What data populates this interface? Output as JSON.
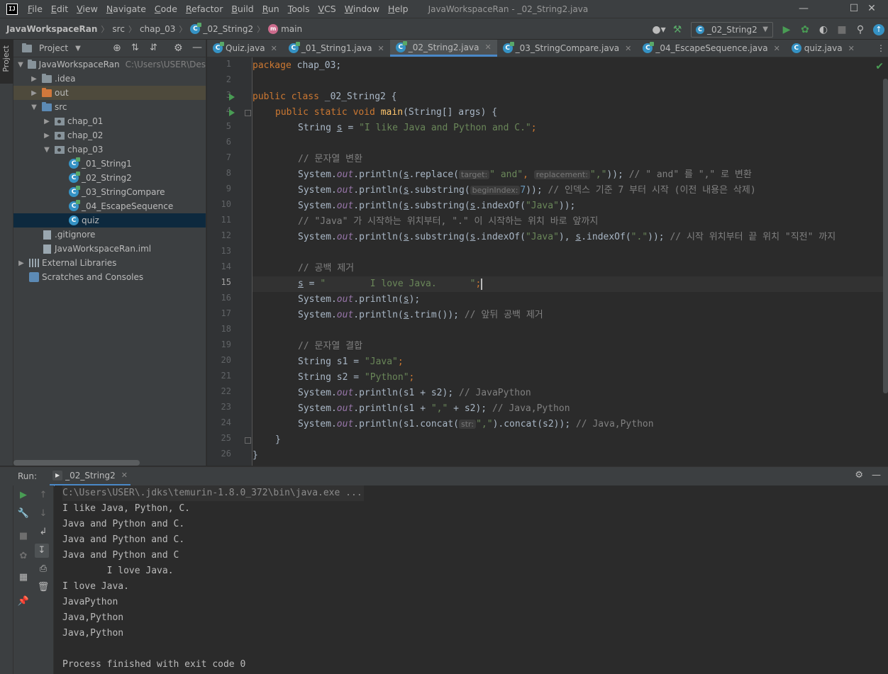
{
  "menu": {
    "items": [
      "File",
      "Edit",
      "View",
      "Navigate",
      "Code",
      "Refactor",
      "Build",
      "Run",
      "Tools",
      "VCS",
      "Window",
      "Help"
    ],
    "window_title": "JavaWorkspaceRan - _02_String2.java",
    "logo_text": "IJ"
  },
  "navbar": {
    "project": "JavaWorkspaceRan",
    "src": "src",
    "package": "chap_03",
    "class": "_02_String2",
    "method": "main",
    "run_config": "_02_String2"
  },
  "project_panel": {
    "title": "Project",
    "tree": {
      "root": "JavaWorkspaceRan",
      "root_path": "C:\\Users\\USER\\Des",
      "idea": ".idea",
      "out": "out",
      "src": "src",
      "chap01": "chap_01",
      "chap02": "chap_02",
      "chap03": "chap_03",
      "f1": "_01_String1",
      "f2": "_02_String2",
      "f3": "_03_StringCompare",
      "f4": "_04_EscapeSequence",
      "f5": "quiz",
      "gitignore": ".gitignore",
      "iml": "JavaWorkspaceRan.iml",
      "libs": "External Libraries",
      "scratches": "Scratches and Consoles"
    }
  },
  "editor_tabs": [
    "Quiz.java",
    "_01_String1.java",
    "_02_String2.java",
    "_03_StringCompare.java",
    "_04_EscapeSequence.java",
    "quiz.java"
  ],
  "editor": {
    "line_numbers": [
      "1",
      "2",
      "3",
      "4",
      "5",
      "6",
      "7",
      "8",
      "9",
      "10",
      "11",
      "12",
      "13",
      "14",
      "15",
      "16",
      "17",
      "18",
      "19",
      "20",
      "21",
      "22",
      "23",
      "24",
      "25",
      "26"
    ],
    "l1": {
      "kw": "package",
      "rest": " chap_03;"
    },
    "l3": {
      "kw": "public class",
      "rest": " _02_String2 {"
    },
    "l4": {
      "kw": "public static void",
      "fn": "main",
      "rest": "(String[] args) {"
    },
    "l5": {
      "a": "String ",
      "v": "s",
      "b": " = ",
      "str": "\"I like Java and Python and C.\"",
      "c": ";"
    },
    "l7": "// 문자열 변환",
    "l8": {
      "a": "System.",
      "out": "out",
      "b": ".println(",
      "v": "s",
      "c": ".replace(",
      "h1": "target:",
      "s1": "\" and\"",
      "d": ", ",
      "h2": "replacement:",
      "s2": "\",\"",
      "e": ")); ",
      "cm": "// \" and\" 를 \",\" 로 변환"
    },
    "l9": {
      "a": "System.",
      "out": "out",
      "b": ".println(",
      "v": "s",
      "c": ".substring(",
      "h1": "beginIndex:",
      "n": "7",
      "e": ")); ",
      "cm": "// 인덱스 기준 7 부터 시작 (이전 내용은 삭제)"
    },
    "l10": {
      "a": "System.",
      "out": "out",
      "b": ".println(",
      "v": "s",
      "c": ".substring(",
      "v2": "s",
      "d": ".indexOf(",
      "s1": "\"Java\"",
      "e": "));"
    },
    "l11": "// \"Java\" 가 시작하는 위치부터, \".\" 이 시작하는 위치 바로 앞까지",
    "l12": {
      "a": "System.",
      "out": "out",
      "b": ".println(",
      "v": "s",
      "c": ".substring(",
      "v2": "s",
      "d": ".indexOf(",
      "s1": "\"Java\"",
      "e": "), ",
      "v3": "s",
      "f": ".indexOf(",
      "s2": "\".\"",
      "g": ")); ",
      "cm": "// 시작 위치부터 끝 위치 \"직전\" 까지"
    },
    "l14": "// 공백 제거",
    "l15": {
      "v": "s",
      "b": " = ",
      "str": "\"        I love Java.      \"",
      "c": ";"
    },
    "l16": {
      "a": "System.",
      "out": "out",
      "b": ".println(",
      "v": "s",
      "e": ");"
    },
    "l17": {
      "a": "System.",
      "out": "out",
      "b": ".println(",
      "v": "s",
      "c": ".trim()); ",
      "cm": "// 앞뒤 공백 제거"
    },
    "l19": "// 문자열 결합",
    "l20": {
      "a": "String s1 = ",
      "str": "\"Java\"",
      "c": ";"
    },
    "l21": {
      "a": "String s2 = ",
      "str": "\"Python\"",
      "c": ";"
    },
    "l22": {
      "a": "System.",
      "out": "out",
      "b": ".println(s1 + s2); ",
      "cm": "// JavaPython"
    },
    "l23": {
      "a": "System.",
      "out": "out",
      "b": ".println(s1 + ",
      "str": "\",\"",
      "c": " + s2); ",
      "cm": "// Java,Python"
    },
    "l24": {
      "a": "System.",
      "out": "out",
      "b": ".println(s1.concat(",
      "h1": "str:",
      "str": "\",\"",
      "c": ").concat(s2)); ",
      "cm": "// Java,Python"
    },
    "l25": "}",
    "l26": "}"
  },
  "run": {
    "label": "Run:",
    "tab": "_02_String2",
    "console": [
      "C:\\Users\\USER\\.jdks\\temurin-1.8.0_372\\bin\\java.exe ...",
      "I like Java, Python, C.",
      "Java and Python and C.",
      "Java and Python and C.",
      "Java and Python and C",
      "        I love Java.",
      "I love Java.",
      "JavaPython",
      "Java,Python",
      "Java,Python",
      "",
      "Process finished with exit code 0"
    ]
  },
  "colors": {
    "accent": "#4a88c7",
    "keyword": "#cc7832",
    "string": "#6a8759",
    "comment": "#808080",
    "run_green": "#499c54"
  }
}
